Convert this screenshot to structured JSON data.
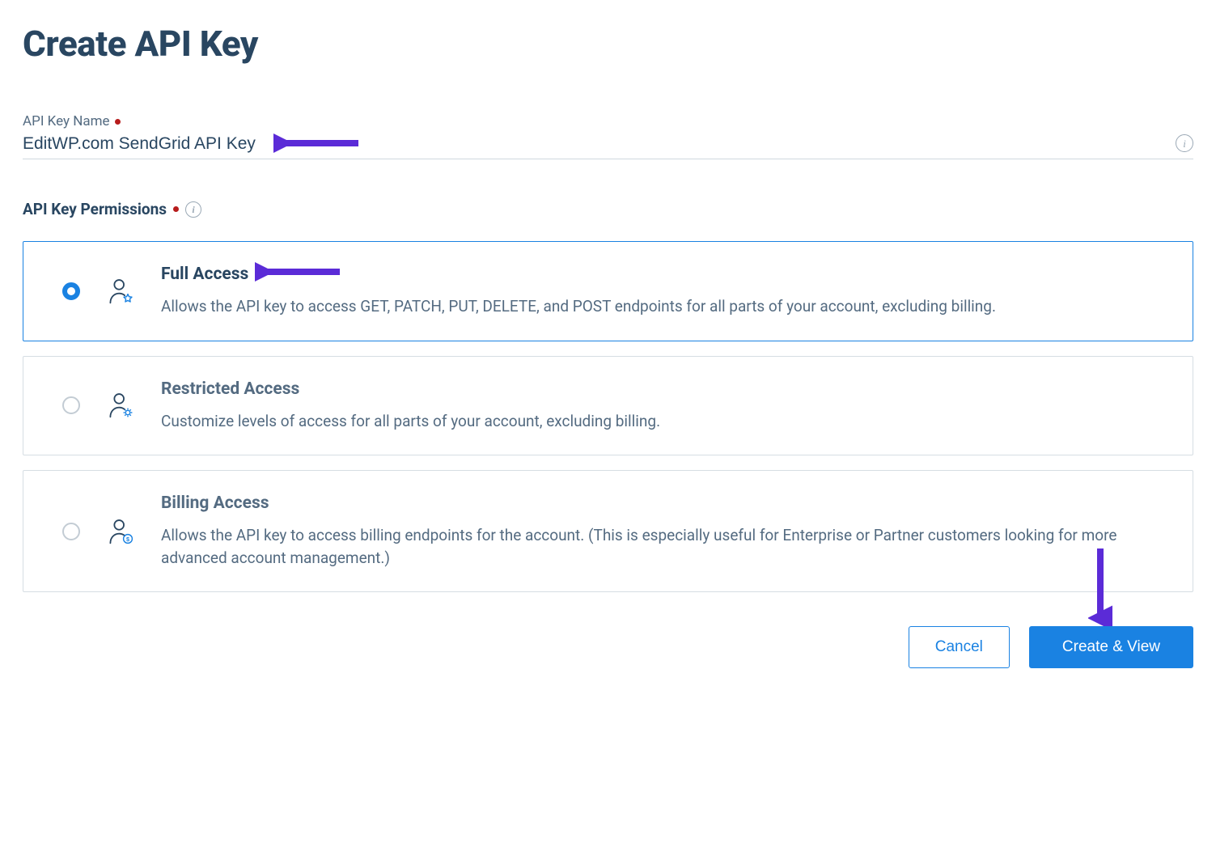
{
  "page": {
    "title": "Create API Key"
  },
  "nameField": {
    "label": "API Key Name",
    "value": "EditWP.com SendGrid API Key"
  },
  "permissions": {
    "label": "API Key Permissions",
    "options": [
      {
        "title": "Full Access",
        "desc": "Allows the API key to access GET, PATCH, PUT, DELETE, and POST endpoints for all parts of your account, excluding billing.",
        "selected": true
      },
      {
        "title": "Restricted Access",
        "desc": "Customize levels of access for all parts of your account, excluding billing.",
        "selected": false
      },
      {
        "title": "Billing Access",
        "desc": "Allows the API key to access billing endpoints for the account. (This is especially useful for Enterprise or Partner customers looking for more advanced account management.)",
        "selected": false
      }
    ]
  },
  "actions": {
    "cancel": "Cancel",
    "create": "Create & View"
  },
  "colors": {
    "primary": "#1a82e2",
    "text": "#294661",
    "muted": "#546b81",
    "annotation": "#5b2bd7"
  }
}
